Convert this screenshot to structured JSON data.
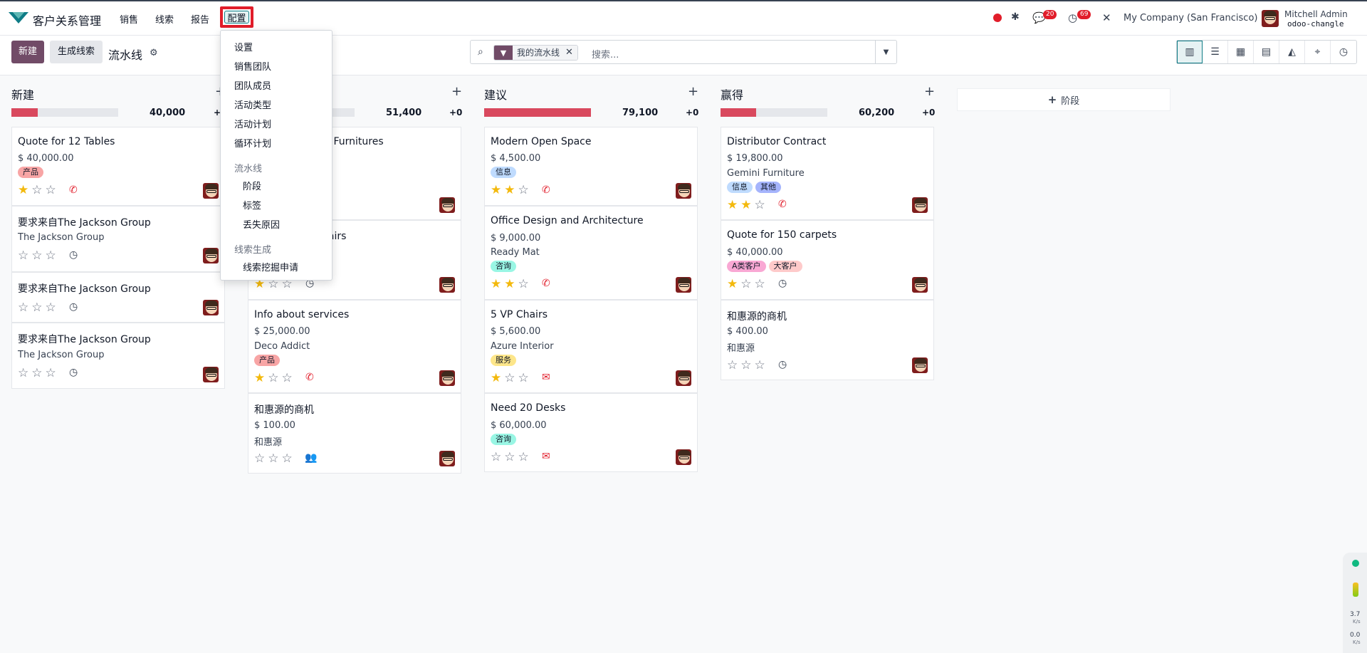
{
  "app": {
    "name": "客户关系管理"
  },
  "menu": {
    "items": [
      "销售",
      "线索",
      "报告"
    ],
    "active": "配置"
  },
  "system": {
    "chat_count": "20",
    "activity_count": "69",
    "company": "My Company (San Francisco)",
    "user_name": "Mitchell Admin",
    "user_db": "odoo-changle"
  },
  "control": {
    "new_label": "新建",
    "generate_label": "生成线索",
    "breadcrumb": "流水线"
  },
  "search": {
    "facet": "我的流水线",
    "placeholder": "搜索..."
  },
  "views": [
    "kanban-icon",
    "list-icon",
    "calendar-icon",
    "pivot-icon",
    "graph-icon",
    "map-icon",
    "activity-icon"
  ],
  "dropdown": {
    "items": [
      "设置",
      "销售团队",
      "团队成员",
      "活动类型",
      "活动计划",
      "循环计划"
    ],
    "pipeline_header": "流水线",
    "pipeline_items": [
      "阶段",
      "标签",
      "丢失原因"
    ],
    "leadgen_header": "线索生成",
    "leadgen_items": [
      "线索挖掘申请"
    ]
  },
  "columns": [
    {
      "title": "新建",
      "sum": "40,000",
      "plus": "+0",
      "fill_fraction": 0.25
    },
    {
      "title": "",
      "sum": "51,400",
      "plus": "+0",
      "fill_fraction": 0.0
    },
    {
      "title": "建议",
      "sum": "79,100",
      "plus": "+0",
      "fill_fraction": 1.0
    },
    {
      "title": "赢得",
      "sum": "60,200",
      "plus": "+0",
      "fill_fraction": 0.33
    }
  ],
  "add_stage_label": "阶段",
  "cards": {
    "c1": [
      {
        "title": "Quote for 12 Tables",
        "amount": "$ 40,000.00",
        "tags": [
          "产品"
        ],
        "stars": 1,
        "activity": "phone-icon"
      },
      {
        "title": "要求来自The Jackson Group",
        "sub": "The Jackson Group",
        "stars": 0,
        "activity": "clock-icon"
      },
      {
        "title": "要求来自The Jackson Group",
        "stars": 0,
        "activity": "clock-icon"
      },
      {
        "title": "要求来自The Jackson Group",
        "sub": "The Jackson Group",
        "stars": 0,
        "activity": "clock-icon"
      }
    ],
    "c2": [
      {
        "title": "s: Furnitures"
      },
      {
        "title": "hairs",
        "stars": 1,
        "activity": "clock-icon"
      },
      {
        "title": "Info about services",
        "amount": "$ 25,000.00",
        "sub": "Deco Addict",
        "tags": [
          "产品"
        ],
        "stars": 1,
        "activity": "phone-icon"
      },
      {
        "title": "和惠源的商机",
        "amount": "$ 100.00",
        "sub": "和惠源",
        "stars": 0,
        "activity": "users-icon"
      }
    ],
    "c3": [
      {
        "title": "Modern Open Space",
        "amount": "$ 4,500.00",
        "tags": [
          "信息"
        ],
        "stars": 2,
        "activity": "phone-icon"
      },
      {
        "title": "Office Design and Architecture",
        "amount": "$ 9,000.00",
        "sub": "Ready Mat",
        "tags": [
          "咨询"
        ],
        "stars": 2,
        "activity": "phone-icon"
      },
      {
        "title": "5 VP Chairs",
        "amount": "$ 5,600.00",
        "sub": "Azure Interior",
        "tags": [
          "服务"
        ],
        "stars": 1,
        "activity": "envelope-icon"
      },
      {
        "title": "Need 20 Desks",
        "amount": "$ 60,000.00",
        "tags": [
          "咨询"
        ],
        "stars": 0,
        "activity": "envelope-icon"
      }
    ],
    "c4": [
      {
        "title": "Distributor Contract",
        "amount": "$ 19,800.00",
        "sub": "Gemini Furniture",
        "tags": [
          "信息",
          "其他"
        ],
        "stars": 2,
        "activity": "phone-icon"
      },
      {
        "title": "Quote for 150 carpets",
        "amount": "$ 40,000.00",
        "tags": [
          "A类客户",
          "大客户"
        ],
        "stars": 1,
        "activity": "clock-icon"
      },
      {
        "title": "和惠源的商机",
        "amount": "$ 400.00",
        "sub": "和惠源",
        "stars": 0,
        "activity": "clock-icon"
      }
    ]
  },
  "colors": {
    "brand": "#714b67",
    "danger": "#d9495e",
    "highlight": "#e11d2a"
  },
  "widget": {
    "up": "3.7",
    "up_unit": "K/s",
    "down": "0.0",
    "down_unit": "K/s"
  }
}
